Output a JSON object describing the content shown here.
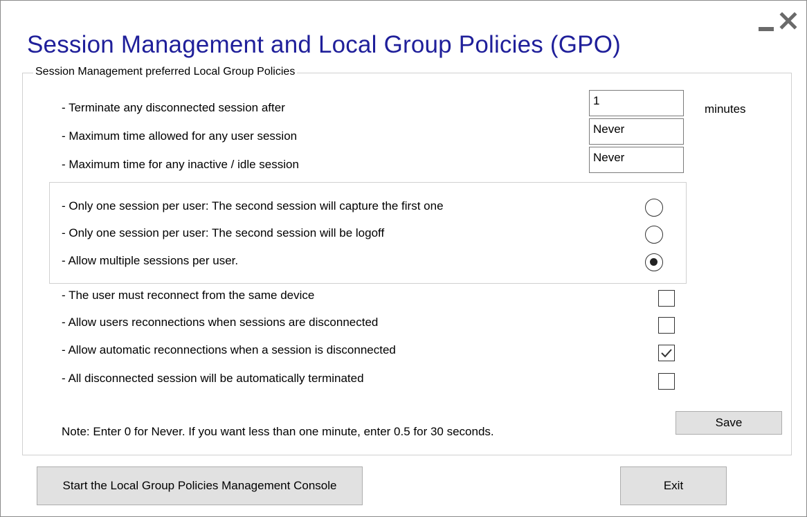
{
  "window": {
    "title": "Session Management and Local Group Policies (GPO)",
    "minimize_icon": "minimize-icon",
    "close_icon": "close-icon"
  },
  "groupbox": {
    "legend": "Session Management preferred Local Group Policies"
  },
  "time_settings": [
    {
      "label": "- Terminate any disconnected session after",
      "value": "1"
    },
    {
      "label": "- Maximum time allowed for any user session",
      "value": "Never"
    },
    {
      "label": "- Maximum time for any inactive / idle session",
      "value": "Never"
    }
  ],
  "units_label": "minutes",
  "session_mode": {
    "options": [
      {
        "label": "- Only one session per user: The second session will capture the first one",
        "selected": false
      },
      {
        "label": "- Only one session per user: The second session will be logoff",
        "selected": false
      },
      {
        "label": "- Allow multiple sessions per user.",
        "selected": true
      }
    ]
  },
  "reconnection_options": [
    {
      "label": "- The user must reconnect from the same device",
      "checked": false
    },
    {
      "label": "- Allow users reconnections when sessions are disconnected",
      "checked": false
    },
    {
      "label": "- Allow automatic reconnections when a session is disconnected",
      "checked": true
    },
    {
      "label": "- All disconnected session will be automatically terminated",
      "checked": false
    }
  ],
  "note": "Note: Enter 0 for Never. If you want less than one minute, enter 0.5 for 30 seconds.",
  "buttons": {
    "save": "Save",
    "start_console": "Start the Local Group Policies Management Console",
    "exit": "Exit"
  }
}
